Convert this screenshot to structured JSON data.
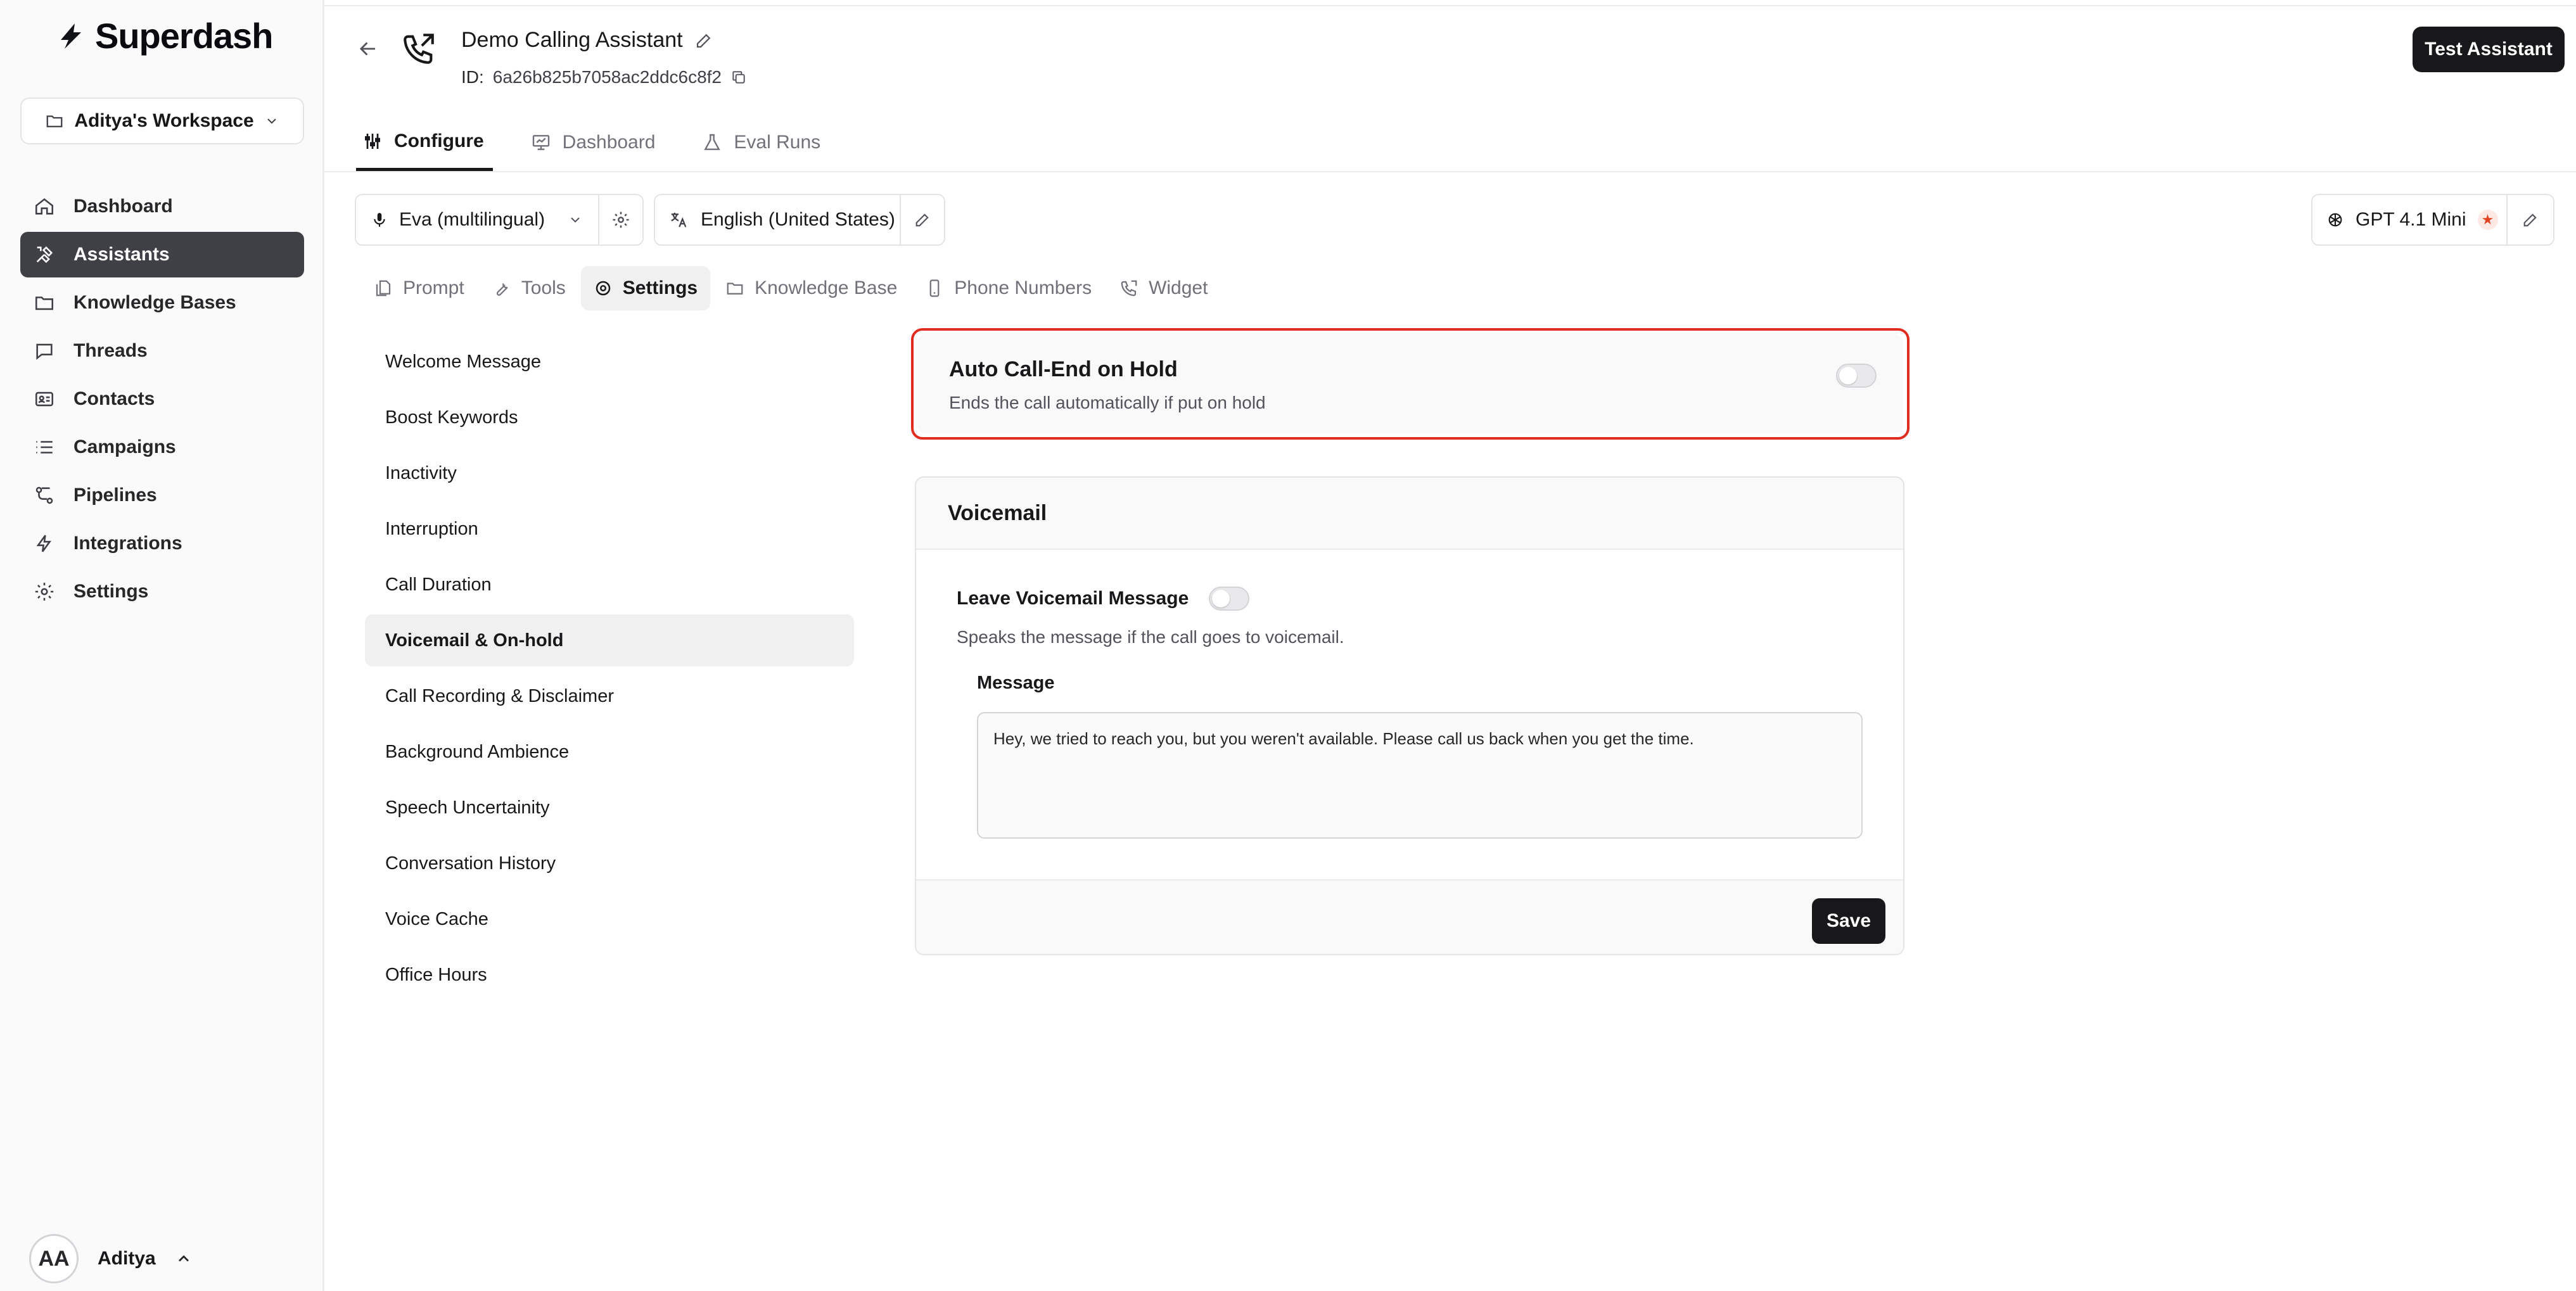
{
  "brand": {
    "name": "Superdash"
  },
  "workspace": {
    "label": "Aditya's Workspace"
  },
  "nav": {
    "items": [
      {
        "label": "Dashboard",
        "icon": "home-icon"
      },
      {
        "label": "Assistants",
        "icon": "tools-icon",
        "active": true
      },
      {
        "label": "Knowledge Bases",
        "icon": "folder-icon"
      },
      {
        "label": "Threads",
        "icon": "chat-icon"
      },
      {
        "label": "Contacts",
        "icon": "id-card-icon"
      },
      {
        "label": "Campaigns",
        "icon": "list-icon"
      },
      {
        "label": "Pipelines",
        "icon": "workflow-icon"
      },
      {
        "label": "Integrations",
        "icon": "bolt-icon"
      },
      {
        "label": "Settings",
        "icon": "gear-icon"
      }
    ]
  },
  "user": {
    "initials": "AA",
    "name": "Aditya"
  },
  "assistant": {
    "title": "Demo Calling Assistant",
    "id_label": "ID:",
    "id_value": "6a26b825b7058ac2ddc6c8f2"
  },
  "header": {
    "test_button": "Test Assistant"
  },
  "main_tabs": [
    {
      "label": "Configure",
      "active": true
    },
    {
      "label": "Dashboard"
    },
    {
      "label": "Eval Runs"
    }
  ],
  "voice": {
    "label": "Eva (multilingual)"
  },
  "language": {
    "label": "English (United States)"
  },
  "model": {
    "label": "GPT 4.1 Mini"
  },
  "sub_tabs": [
    {
      "label": "Prompt"
    },
    {
      "label": "Tools"
    },
    {
      "label": "Settings",
      "active": true
    },
    {
      "label": "Knowledge Base"
    },
    {
      "label": "Phone Numbers"
    },
    {
      "label": "Widget"
    }
  ],
  "settings_list": [
    "Welcome Message",
    "Boost Keywords",
    "Inactivity",
    "Interruption",
    "Call Duration",
    "Voicemail & On-hold",
    "Call Recording & Disclaimer",
    "Background Ambience",
    "Speech Uncertainity",
    "Conversation History",
    "Voice Cache",
    "Office Hours"
  ],
  "auto_call_end": {
    "title": "Auto Call-End on Hold",
    "description": "Ends the call automatically if put on hold",
    "enabled": false
  },
  "voicemail": {
    "title": "Voicemail",
    "leave_label": "Leave Voicemail Message",
    "leave_enabled": false,
    "leave_description": "Speaks the message if the call goes to voicemail.",
    "message_label": "Message",
    "message_value": "Hey, we tried to reach you, but you weren't available. Please call us back when you get the time.",
    "save_button": "Save"
  },
  "colors": {
    "accent_dark": "#18181b",
    "highlight_red": "#e12d1f",
    "sidebar_active": "#3f3f46"
  }
}
